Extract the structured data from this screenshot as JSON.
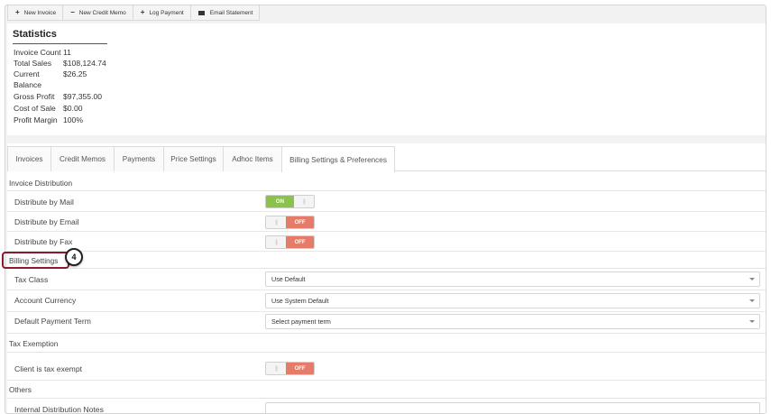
{
  "toolbar": {
    "new_invoice": "New Invoice",
    "new_credit_memo": "New Credit Memo",
    "log_payment": "Log Payment",
    "email_statement": "Email Statement"
  },
  "statistics": {
    "title": "Statistics",
    "rows": [
      {
        "label": "Invoice Count",
        "value": "11"
      },
      {
        "label": "Total Sales",
        "value": "$108,124.74"
      },
      {
        "label": "Current",
        "value": "$26.25"
      },
      {
        "label": "Balance",
        "value": ""
      },
      {
        "label": "Gross Profit",
        "value": "$97,355.00"
      },
      {
        "label": "Cost of Sale",
        "value": "$0.00"
      },
      {
        "label": "Profit Margin",
        "value": "100%"
      }
    ]
  },
  "tabs": [
    {
      "label": "Invoices",
      "active": false
    },
    {
      "label": "Credit Memos",
      "active": false
    },
    {
      "label": "Payments",
      "active": false
    },
    {
      "label": "Price Settings",
      "active": false
    },
    {
      "label": "Adhoc Items",
      "active": false
    },
    {
      "label": "Billing Settings & Preferences",
      "active": true
    }
  ],
  "sections": {
    "invoice_distribution": "Invoice Distribution",
    "billing_settings": "Billing Settings",
    "tax_exemption": "Tax Exemption",
    "others": "Others"
  },
  "distribution": {
    "mail": {
      "label": "Distribute by Mail",
      "state": "ON"
    },
    "email": {
      "label": "Distribute by Email",
      "state": "OFF"
    },
    "fax": {
      "label": "Distribute by Fax",
      "state": "OFF"
    }
  },
  "billing": {
    "tax_class": {
      "label": "Tax Class",
      "value": "Use Default"
    },
    "account_currency": {
      "label": "Account Currency",
      "value": "Use System Default"
    },
    "payment_term": {
      "label": "Default Payment Term",
      "value": "Select payment term"
    }
  },
  "tax_exemption": {
    "client_exempt": {
      "label": "Client is tax exempt",
      "state": "OFF"
    }
  },
  "others": {
    "internal_notes": {
      "label": "Internal Distribution Notes",
      "value": ""
    }
  },
  "annotation": {
    "step": "4",
    "color": "#8b1a2b"
  },
  "colors": {
    "on": "#8bc34a",
    "off": "#e57c6a"
  },
  "toggle_knob": "|||"
}
